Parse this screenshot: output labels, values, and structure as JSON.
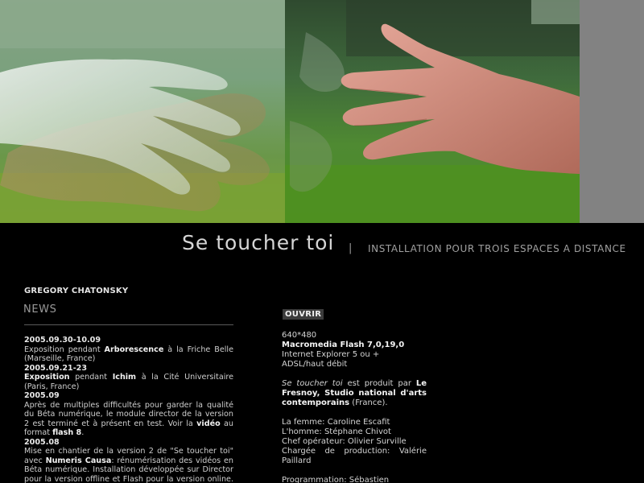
{
  "header": {
    "title": "Se toucher toi",
    "separator": "|",
    "subtitle": "INSTALLATION POUR TROIS ESPACES A DISTANCE"
  },
  "author": "GREGORY CHATONSKY",
  "news": {
    "heading": "NEWS",
    "entries": [
      {
        "date": "2005.09.30-10.09",
        "pre": "Exposition pendant ",
        "bold": "Arborescence",
        "post": " à la Friche Belle (Marseille, France)"
      },
      {
        "date": "2005.09.21-23",
        "bold": "Exposition",
        "mid": " pendant ",
        "bold2": "Ichim",
        "post": " à la Cité Universitaire (Paris, France)"
      },
      {
        "date": "2005.09",
        "pre": "Après de multiples difficultés pour garder la qualité du Béta numérique, le module director de la version 2 est terminé et à présent en test. Voir la ",
        "bold": "vidéo",
        "mid": " au format ",
        "bold2": "flash 8",
        "post": "."
      },
      {
        "date": "2005.08",
        "pre": "Mise en chantier de la version 2 de \"Se toucher toi\" avec ",
        "bold": "Numeris Causa",
        "post": ": rénumérisation des vidéos en Béta numérique. Installation développée sur Director pour la version offline et Flash pour la version online. Utilisation"
      }
    ]
  },
  "open_button": "OUVRIR",
  "info": {
    "resolution": "640*480",
    "plugin": "Macromedia Flash 7,0,19,0",
    "browser": "Internet Explorer 5 ou +",
    "connection": "ADSL/haut débit",
    "production_title": "Se toucher toi",
    "production_mid": " est produit par ",
    "producer": "Le Fresnoy, Studio national d'arts contemporains",
    "production_end": " (France).",
    "credits": [
      "La femme: Caroline Escafit",
      "L'homme: Stéphane Chivot",
      "Chef opérateur: Olivier Surville",
      "Chargée de production: Valérie Paillard"
    ],
    "programming": "Programmation: Sébastien"
  },
  "colors": {
    "background": "#000000",
    "title": "#d6d6d6",
    "subtitle": "#a0a0a0",
    "button_bg": "#3c3c3c",
    "side_gray": "#828282"
  }
}
